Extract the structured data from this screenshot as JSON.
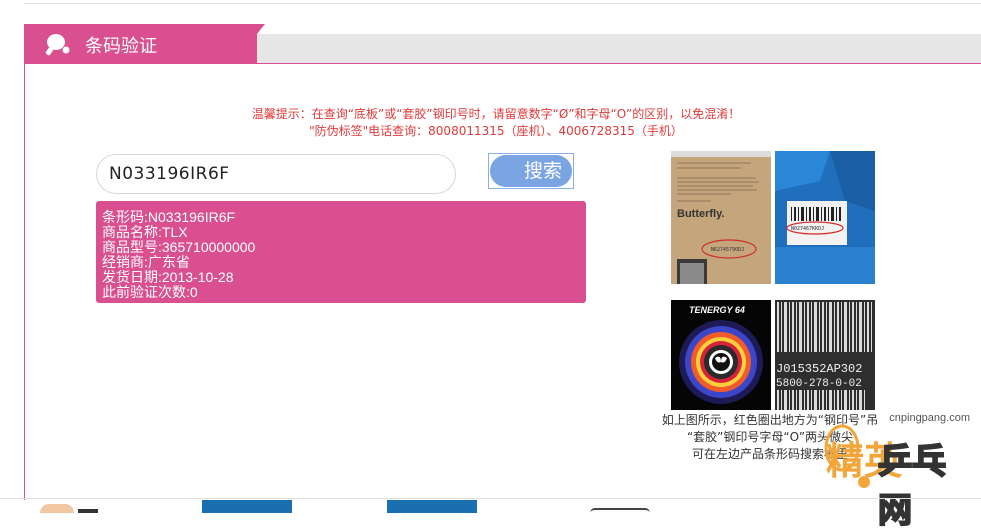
{
  "header": {
    "title": "条码验证"
  },
  "notice": {
    "line1": "温馨提示：在查询“底板”或“套胶”钢印号时，请留意数字“Ø”和字母“O”的区别，以免混淆！",
    "line2": "\"防伪标签\"电话查询：8008011315（座机）、4006728315（手机）"
  },
  "search": {
    "value": "N033196IR6F",
    "button_label": "搜索"
  },
  "result": {
    "lines": [
      "条形码:N033196IR6F",
      "商品名称:TLX",
      "商品型号:365710000000",
      "经销商:广东省",
      "发货日期:2013-10-28",
      "此前验证次数:0"
    ]
  },
  "photos": {
    "blade_brand": "Butterfly.",
    "blade_code": "N6274579ODJ",
    "box_code": "N027467KKDJ",
    "rubber_brand": "TENERGY 64",
    "barcode_line1": "J015352AP302",
    "barcode_line2": "5800-278-0-02"
  },
  "caption": {
    "line1": "如上图所示，红色圈出地方为“钢印号”吊",
    "line2": "“套胶”钢印号字母“O”两头微尖",
    "line3": "可在左边产品条形码搜索框里"
  },
  "watermark": {
    "url": "cnpingpang.com",
    "text_a": "精英",
    "text_b": "乒乓网"
  },
  "colors": {
    "accent": "#d94f8f",
    "notice": "#e03a3a",
    "button": "#7ba4e2"
  }
}
